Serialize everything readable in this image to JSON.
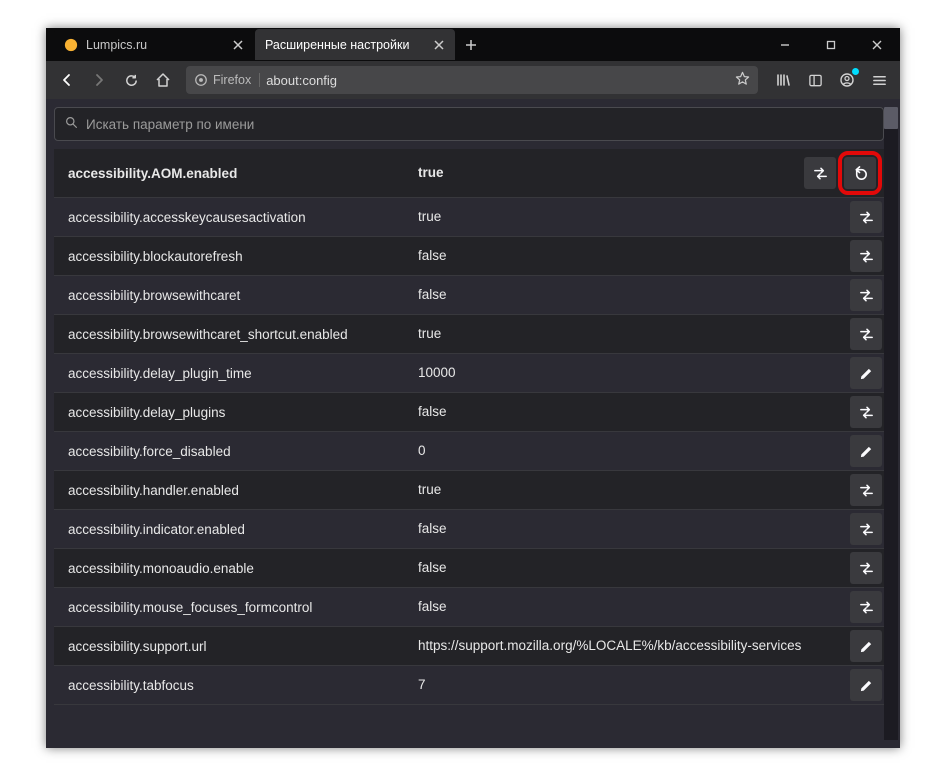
{
  "tabs": [
    {
      "title": "Lumpics.ru",
      "active": false
    },
    {
      "title": "Расширенные настройки",
      "active": true
    }
  ],
  "urlbar": {
    "identity": "Firefox",
    "url": "about:config"
  },
  "search": {
    "placeholder": "Искать параметр по имени"
  },
  "prefs": [
    {
      "name": "accessibility.AOM.enabled",
      "value": "true",
      "action": "toggle",
      "modified": true,
      "reset": true
    },
    {
      "name": "accessibility.accesskeycausesactivation",
      "value": "true",
      "action": "toggle"
    },
    {
      "name": "accessibility.blockautorefresh",
      "value": "false",
      "action": "toggle"
    },
    {
      "name": "accessibility.browsewithcaret",
      "value": "false",
      "action": "toggle"
    },
    {
      "name": "accessibility.browsewithcaret_shortcut.enabled",
      "value": "true",
      "action": "toggle"
    },
    {
      "name": "accessibility.delay_plugin_time",
      "value": "10000",
      "action": "edit"
    },
    {
      "name": "accessibility.delay_plugins",
      "value": "false",
      "action": "toggle"
    },
    {
      "name": "accessibility.force_disabled",
      "value": "0",
      "action": "edit"
    },
    {
      "name": "accessibility.handler.enabled",
      "value": "true",
      "action": "toggle"
    },
    {
      "name": "accessibility.indicator.enabled",
      "value": "false",
      "action": "toggle"
    },
    {
      "name": "accessibility.monoaudio.enable",
      "value": "false",
      "action": "toggle"
    },
    {
      "name": "accessibility.mouse_focuses_formcontrol",
      "value": "false",
      "action": "toggle"
    },
    {
      "name": "accessibility.support.url",
      "value": "https://support.mozilla.org/%LOCALE%/kb/accessibility-services",
      "action": "edit"
    },
    {
      "name": "accessibility.tabfocus",
      "value": "7",
      "action": "edit"
    }
  ]
}
